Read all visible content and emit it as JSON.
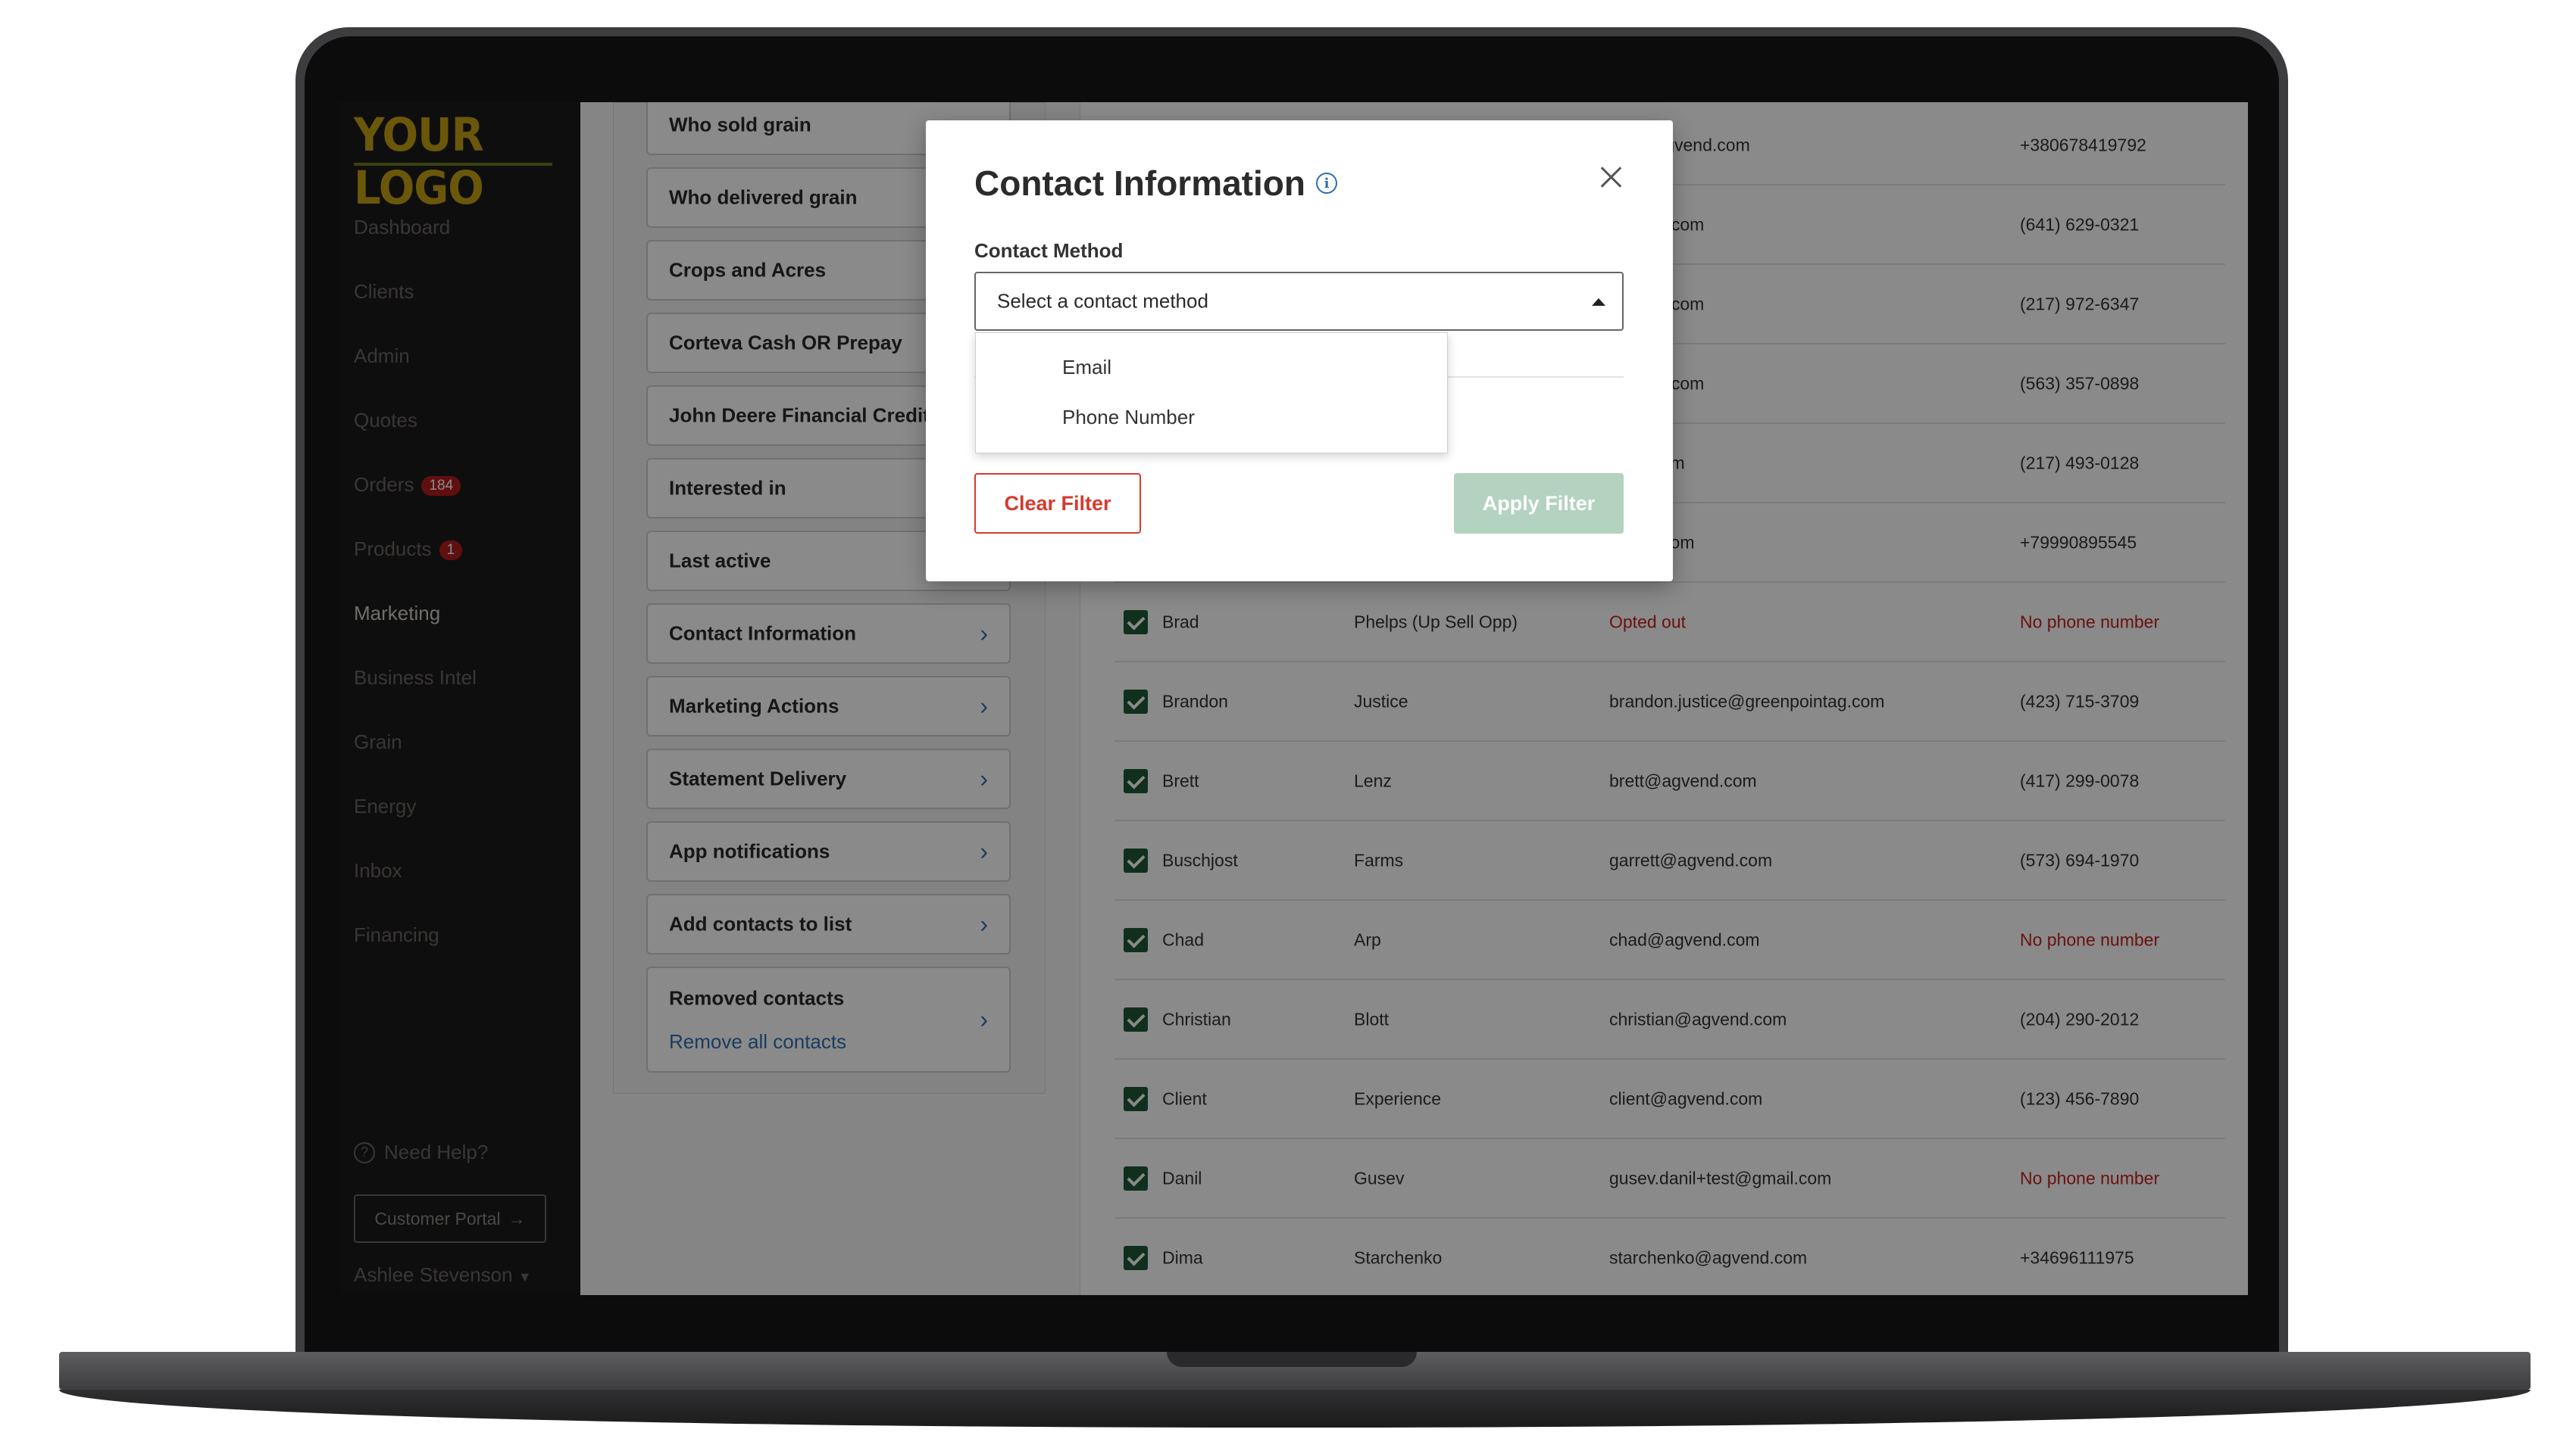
{
  "sidebar": {
    "logo": "YOUR LOGO",
    "items": [
      {
        "label": "Dashboard"
      },
      {
        "label": "Clients"
      },
      {
        "label": "Admin"
      },
      {
        "label": "Quotes"
      },
      {
        "label": "Orders",
        "badge": "184"
      },
      {
        "label": "Products",
        "badge": "1"
      },
      {
        "label": "Marketing",
        "active": true
      },
      {
        "label": "Business Intel"
      },
      {
        "label": "Grain"
      },
      {
        "label": "Energy"
      },
      {
        "label": "Inbox"
      },
      {
        "label": "Financing"
      }
    ],
    "help_label": "Need Help?",
    "help_icon": "question-circle-icon",
    "portal_button": "Customer Portal",
    "user_name": "Ashlee Stevenson"
  },
  "filters": [
    {
      "label": "Who sold grain"
    },
    {
      "label": "Who delivered grain"
    },
    {
      "label": "Crops and Acres"
    },
    {
      "label": "Corteva Cash OR Prepay"
    },
    {
      "label": "John Deere Financial Credit"
    },
    {
      "label": "Interested in"
    },
    {
      "label": "Last active"
    },
    {
      "label": "Contact Information"
    },
    {
      "label": "Marketing Actions"
    },
    {
      "label": "Statement Delivery"
    },
    {
      "label": "App notifications"
    },
    {
      "label": "Add contacts to list"
    },
    {
      "label": "Removed contacts",
      "link": "Remove all contacts"
    }
  ],
  "contacts": [
    {
      "first": "",
      "last": "",
      "email": "nko@agvend.com",
      "phone": "+380678419792"
    },
    {
      "first": "",
      "last": "",
      "email": "agvend.com",
      "phone": "(641) 629-0321"
    },
    {
      "first": "",
      "last": "",
      "email": "agvend.com",
      "phone": "(217) 972-6347"
    },
    {
      "first": "",
      "last": "",
      "email": "agvend.com",
      "phone": "(563) 357-0898"
    },
    {
      "first": "",
      "last": "",
      "email": "vend.com",
      "phone": "(217) 493-0128"
    },
    {
      "first": "",
      "last": "",
      "email": "gvend.com",
      "phone": "+79990895545"
    },
    {
      "first": "Brad",
      "last": "Phelps (Up Sell Opp)",
      "email": "Opted out",
      "phone": "No phone number",
      "email_red": true,
      "phone_red": true
    },
    {
      "first": "Brandon",
      "last": "Justice",
      "email": "brandon.justice@greenpointag.com",
      "phone": "(423) 715-3709"
    },
    {
      "first": "Brett",
      "last": "Lenz",
      "email": "brett@agvend.com",
      "phone": "(417) 299-0078"
    },
    {
      "first": "Buschjost",
      "last": "Farms",
      "email": "garrett@agvend.com",
      "phone": "(573) 694-1970"
    },
    {
      "first": "Chad",
      "last": "Arp",
      "email": "chad@agvend.com",
      "phone": "No phone number",
      "phone_red": true
    },
    {
      "first": "Christian",
      "last": "Blott",
      "email": "christian@agvend.com",
      "phone": "(204) 290-2012"
    },
    {
      "first": "Client",
      "last": "Experience",
      "email": "client@agvend.com",
      "phone": "(123) 456-7890"
    },
    {
      "first": "Danil",
      "last": "Gusev",
      "email": "gusev.danil+test@gmail.com",
      "phone": "No phone number",
      "phone_red": true
    },
    {
      "first": "Dima",
      "last": "Starchenko",
      "email": "starchenko@agvend.com",
      "phone": "+34696111975"
    }
  ],
  "modal": {
    "title": "Contact Information",
    "field_label": "Contact Method",
    "select_value": "Select a contact method",
    "options": [
      "Email",
      "Phone Number"
    ],
    "clear_button": "Clear Filter",
    "apply_button": "Apply Filter"
  },
  "colors": {
    "accent": "#2f6fb3",
    "danger": "#d43b30",
    "checkbox": "#1f5a37",
    "apply_disabled": "#b3d2c0"
  }
}
